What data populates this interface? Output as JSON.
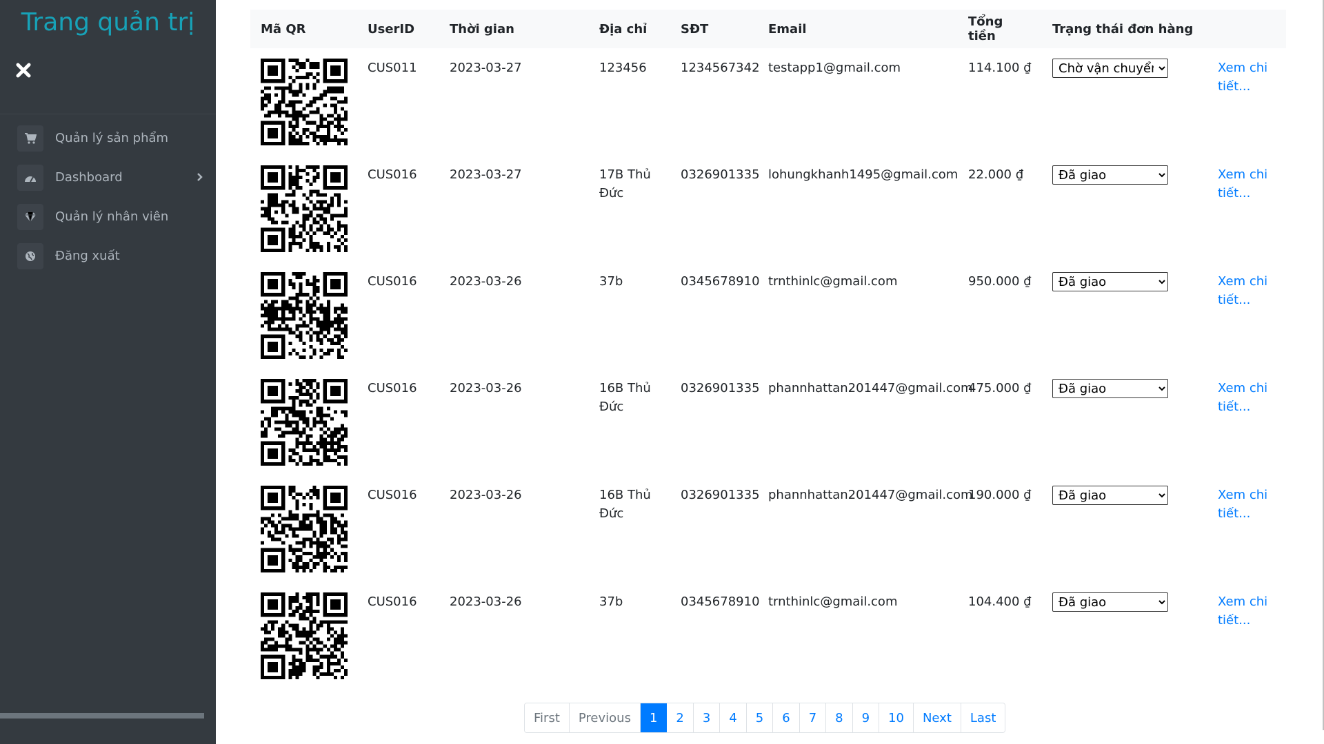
{
  "sidebar": {
    "brand": "Trang quản trị",
    "items": [
      {
        "label": "Quản lý sản phẩm",
        "icon": "cart-icon"
      },
      {
        "label": "Dashboard",
        "icon": "dashboard-icon"
      },
      {
        "label": "Quản lý nhân viên",
        "icon": "diamond-icon"
      },
      {
        "label": "Đăng xuất",
        "icon": "globe-icon"
      }
    ]
  },
  "table": {
    "headers": [
      "Mã QR",
      "UserID",
      "Thời gian",
      "Địa chỉ",
      "SĐT",
      "Email",
      "Tổng tiền",
      "Trạng thái đơn hàng",
      ""
    ],
    "detail_label": "Xem chi tiết...",
    "status_options": [
      "Chờ vận chuyển",
      "Đã giao"
    ],
    "rows": [
      {
        "user_id": "CUS011",
        "time": "2023-03-27",
        "address": "123456",
        "phone": "1234567342",
        "email": "testapp1@gmail.com",
        "total": "114.100 ₫",
        "status": "Chờ vận chuyển"
      },
      {
        "user_id": "CUS016",
        "time": "2023-03-27",
        "address": "17B Thủ Đức",
        "phone": "0326901335",
        "email": "lohungkhanh1495@gmail.com",
        "total": "22.000 ₫",
        "status": "Đã giao"
      },
      {
        "user_id": "CUS016",
        "time": "2023-03-26",
        "address": "37b",
        "phone": "0345678910",
        "email": "trnthinlc@gmail.com",
        "total": "950.000 ₫",
        "status": "Đã giao"
      },
      {
        "user_id": "CUS016",
        "time": "2023-03-26",
        "address": "16B Thủ Đức",
        "phone": "0326901335",
        "email": "phannhattan201447@gmail.com",
        "total": "475.000 ₫",
        "status": "Đã giao"
      },
      {
        "user_id": "CUS016",
        "time": "2023-03-26",
        "address": "16B Thủ Đức",
        "phone": "0326901335",
        "email": "phannhattan201447@gmail.com",
        "total": "190.000 ₫",
        "status": "Đã giao"
      },
      {
        "user_id": "CUS016",
        "time": "2023-03-26",
        "address": "37b",
        "phone": "0345678910",
        "email": "trnthinlc@gmail.com",
        "total": "104.400 ₫",
        "status": "Đã giao"
      }
    ]
  },
  "pagination": {
    "first": "First",
    "previous": "Previous",
    "pages": [
      "1",
      "2",
      "3",
      "4",
      "5",
      "6",
      "7",
      "8",
      "9",
      "10"
    ],
    "active": "1",
    "next": "Next",
    "last": "Last"
  },
  "colors": {
    "sidebar_bg": "#343a40",
    "brand": "#17a2b8",
    "link": "#007bff",
    "active_page": "#007bff"
  }
}
